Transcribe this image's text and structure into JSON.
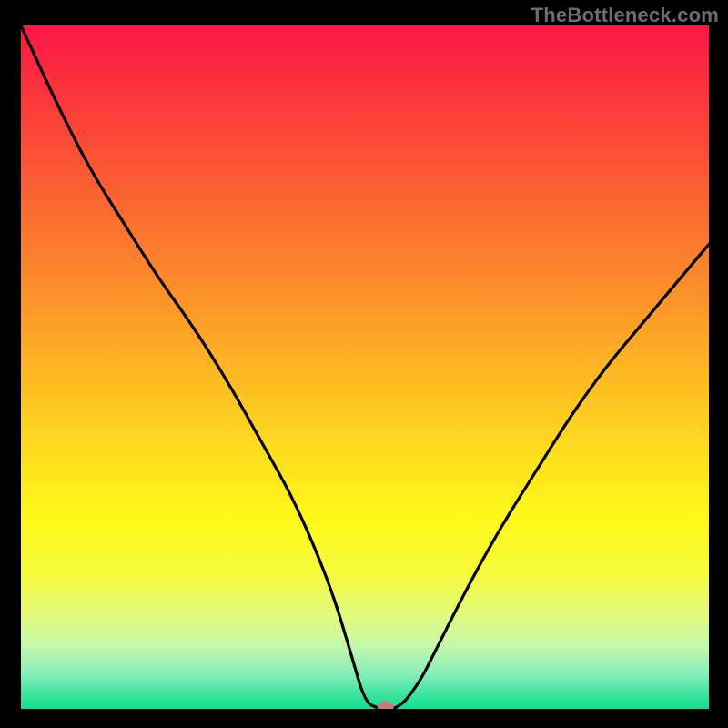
{
  "watermark": "TheBottleneck.com",
  "gradient": {
    "stops": [
      {
        "offset": 0.0,
        "color": "#fb1745"
      },
      {
        "offset": 0.12,
        "color": "#fb3b3a"
      },
      {
        "offset": 0.25,
        "color": "#fb6432"
      },
      {
        "offset": 0.38,
        "color": "#fb8d2b"
      },
      {
        "offset": 0.5,
        "color": "#fdb524"
      },
      {
        "offset": 0.62,
        "color": "#fddc1e"
      },
      {
        "offset": 0.72,
        "color": "#fef81a"
      },
      {
        "offset": 0.8,
        "color": "#f5fa3b"
      },
      {
        "offset": 0.86,
        "color": "#e4fa79"
      },
      {
        "offset": 0.91,
        "color": "#c3f7ae"
      },
      {
        "offset": 0.95,
        "color": "#84edb8"
      },
      {
        "offset": 0.985,
        "color": "#2de39b"
      },
      {
        "offset": 1.0,
        "color": "#10df91"
      }
    ]
  },
  "chart_data": {
    "type": "line",
    "title": "",
    "xlabel": "",
    "ylabel": "",
    "xlim": [
      0,
      100
    ],
    "ylim": [
      0,
      100
    ],
    "series": [
      {
        "name": "curve",
        "x": [
          0,
          5,
          10,
          15,
          20,
          25,
          30,
          35,
          40,
          45,
          48,
          50,
          52,
          55,
          58,
          60,
          65,
          70,
          75,
          80,
          85,
          90,
          95,
          100
        ],
        "y": [
          100,
          89,
          79,
          71,
          63,
          56,
          48,
          39,
          30,
          18,
          8,
          1,
          0,
          0,
          4,
          8,
          18,
          27,
          35,
          43,
          50,
          56,
          62,
          68
        ]
      }
    ],
    "marker": {
      "x": 53,
      "y": 0.3,
      "color": "#cf7a73"
    },
    "annotations": []
  }
}
